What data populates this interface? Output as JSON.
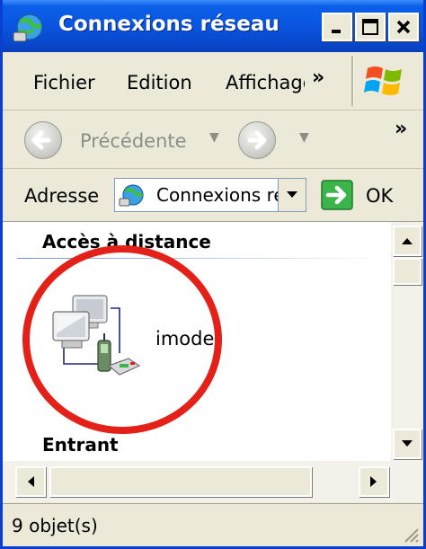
{
  "window": {
    "title": "Connexions réseau",
    "accent": "#0a55e0"
  },
  "menubar": {
    "file": "Fichier",
    "edit": "Edition",
    "view": "Affichage",
    "more": "»"
  },
  "navbar": {
    "back_label": "Précédente",
    "more": "»"
  },
  "address": {
    "label": "Adresse",
    "value": "Connexions réseau",
    "go_label": "OK"
  },
  "content": {
    "groups": [
      {
        "title": "Accès à distance"
      },
      {
        "title": "Entrant"
      }
    ],
    "items": [
      {
        "label": "imode",
        "icon": "dialup-connection-icon"
      }
    ],
    "highlight_color": "#e32119"
  },
  "status": {
    "text": "9 objet(s)"
  }
}
